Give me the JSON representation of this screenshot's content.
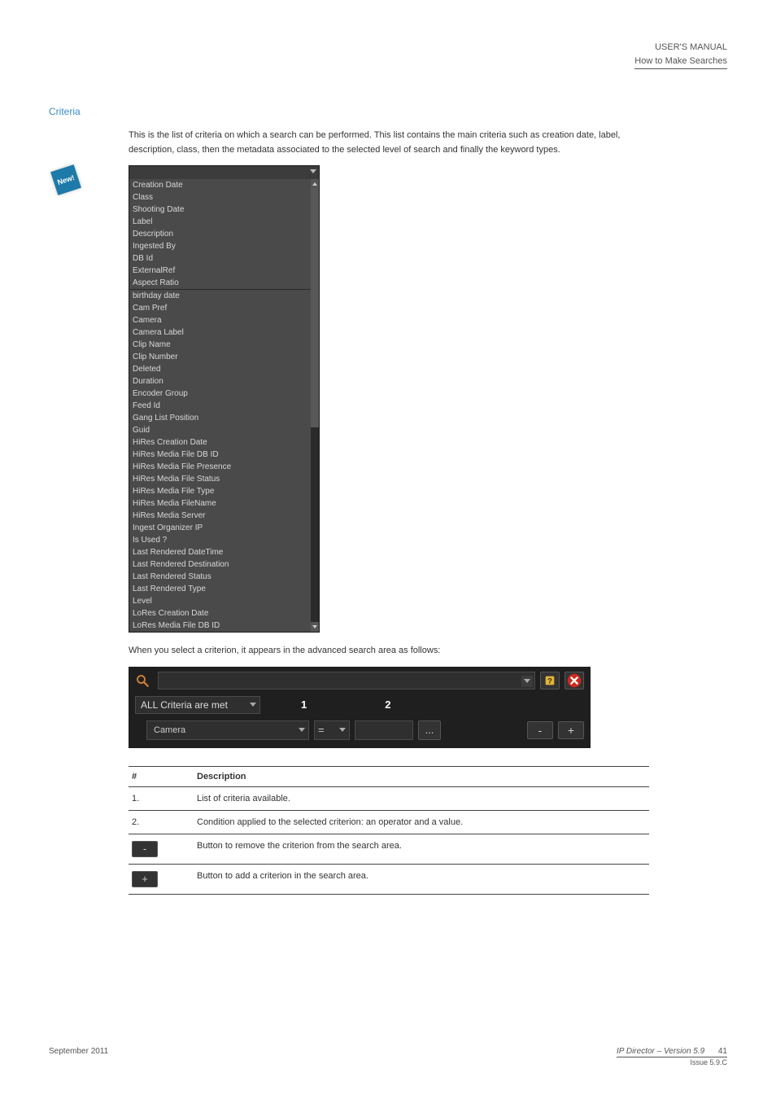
{
  "header": {
    "line1": "USER'S MANUAL",
    "line2": "How to Make Searches"
  },
  "section_title": "Criteria",
  "paragraph1": "This is the list of criteria on which a search can be performed. This list contains the main criteria such as creation date, label, description, class, then the metadata associated to the selected level of search and finally the keyword types.",
  "dropdown": {
    "group1": [
      "Creation Date",
      "Class",
      "Shooting Date",
      "Label",
      "Description",
      "Ingested By",
      "DB Id",
      "ExternalRef",
      "Aspect Ratio"
    ],
    "group2": [
      "birthday date",
      "Cam Pref",
      "Camera",
      "Camera Label",
      "Clip Name",
      "Clip Number",
      "Deleted",
      "Duration",
      "Encoder Group",
      "Feed Id",
      "Gang List Position",
      "Guid",
      "HiRes Creation Date",
      "HiRes Media File DB ID",
      "HiRes Media File Presence",
      "HiRes Media File Status",
      "HiRes Media File Type",
      "HiRes Media FileName",
      "HiRes Media Server",
      "Ingest Organizer IP",
      "Is Used ?",
      "Last Rendered DateTime",
      "Last Rendered Destination",
      "Last Rendered Status",
      "Last Rendered Type",
      "Level",
      "LoRes Creation Date",
      "LoRes Media File DB ID"
    ]
  },
  "paragraph2": "When you select a criterion, it appears in the advanced search area as follows:",
  "criteria_bar": {
    "all_label": "ALL Criteria are met",
    "num1": "1",
    "num2": "2",
    "camera_label": "Camera",
    "eq": "=",
    "dots": "...",
    "minus": "-",
    "plus": "+"
  },
  "table": {
    "heads": [
      "#",
      "Description"
    ],
    "rows": [
      {
        "num": "1.",
        "desc": "List of criteria available."
      },
      {
        "num": "2.",
        "desc": "Condition applied to the selected criterion: an operator and a value."
      },
      {
        "btn": "-",
        "desc": "Button to remove the criterion from the search area."
      },
      {
        "btn": "+",
        "desc": "Button to add a criterion in the search area."
      }
    ]
  },
  "new_badge": "New!",
  "footer": {
    "left": "September 2011",
    "right_main": "IP Director – Version 5.9",
    "right_sub": "Issue 5.9.C",
    "page": "41"
  }
}
